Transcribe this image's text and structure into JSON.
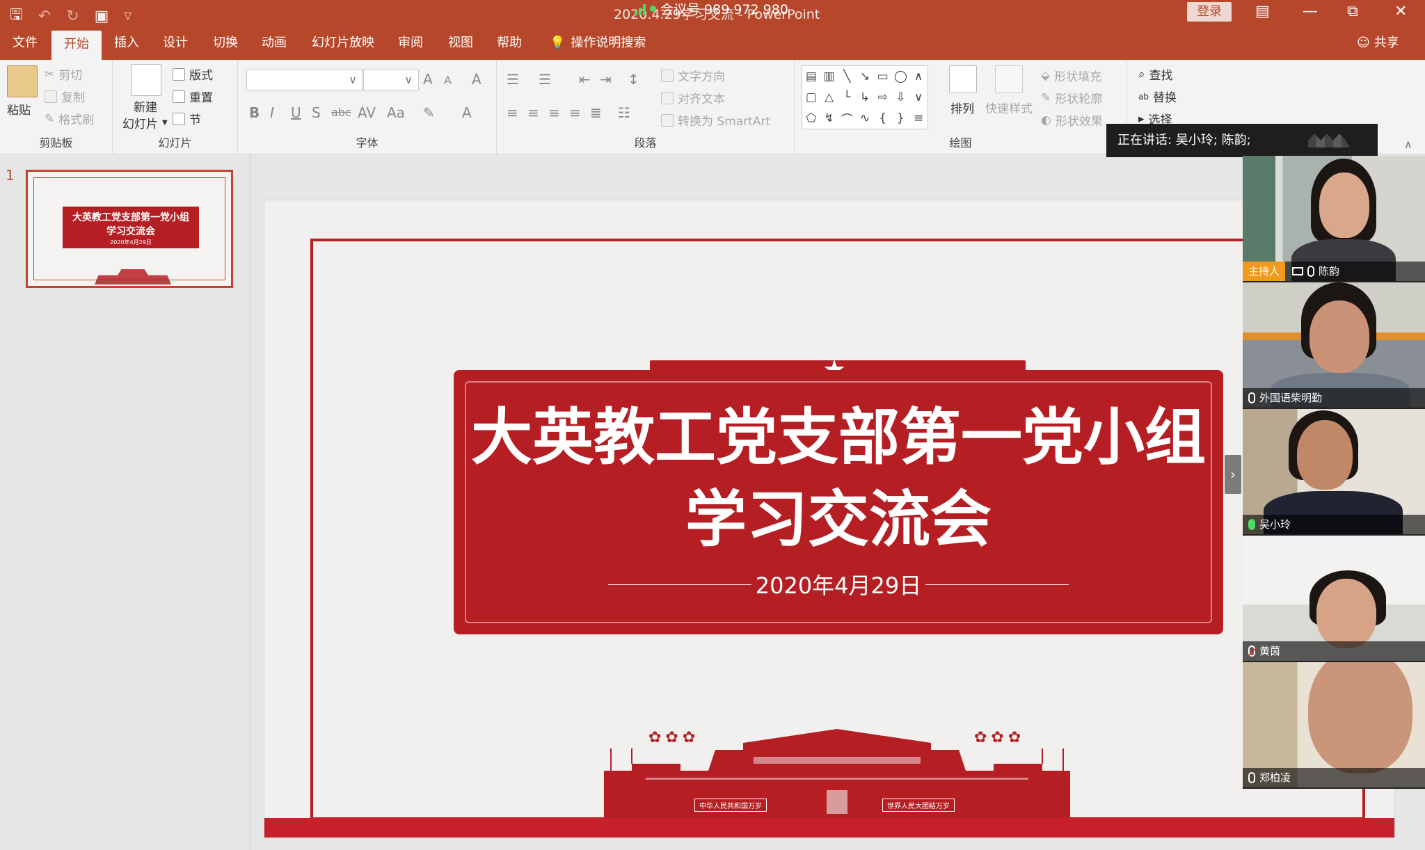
{
  "titlebar": {
    "doc_title": "2020.4.29学习交流 - PowerPoint",
    "meeting_id": "会议号 989 972 980",
    "login": "登录",
    "qat": [
      "save-icon",
      "undo-icon",
      "redo-icon",
      "presenter-icon",
      "customize-icon"
    ]
  },
  "tabs": [
    "文件",
    "开始",
    "插入",
    "设计",
    "切换",
    "动画",
    "幻灯片放映",
    "审阅",
    "视图",
    "帮助"
  ],
  "active_tab": "开始",
  "tell_me": "操作说明搜索",
  "share": "共享",
  "ribbon": {
    "clipboard": {
      "paste": "粘贴",
      "cut": "剪切",
      "copy": "复制",
      "format_painter": "格式刷",
      "label": "剪贴板"
    },
    "slides": {
      "new_slide_1": "新建",
      "new_slide_2": "幻灯片",
      "layout": "版式",
      "reset": "重置",
      "section": "节",
      "label": "幻灯片"
    },
    "font": {
      "label": "字体",
      "bold": "B",
      "italic": "I",
      "underline": "U",
      "shadow": "S",
      "strike": "abc",
      "spacing": "AV",
      "case": "Aa",
      "grow": "A",
      "shrink": "A",
      "clear": "A",
      "color": "A"
    },
    "paragraph": {
      "label": "段落",
      "text_direction": "文字方向",
      "align_text": "对齐文本",
      "smartart": "转换为 SmartArt"
    },
    "drawing": {
      "label": "绘图",
      "arrange": "排列",
      "quick_styles": "快速样式",
      "shape_fill": "形状填充",
      "shape_outline": "形状轮廓",
      "shape_effects": "形状效果"
    },
    "editing": {
      "find": "查找",
      "replace": "替换",
      "select": "选择"
    }
  },
  "thumbnail": {
    "number": "1",
    "title_line1": "大英教工党支部第一党小组",
    "title_line2": "学习交流会",
    "date": "2020年4月29日"
  },
  "slide": {
    "title_line1": "大英教工党支部第一党小组",
    "title_line2": "学习交流会",
    "date": "2020年4月29日",
    "gate_left": "中华人民共和国万岁",
    "gate_right": "世界人民大团结万岁"
  },
  "meeting": {
    "speaking": "正在讲话: 吴小玲; 陈韵;",
    "host_label": "主持人",
    "participants": [
      {
        "name": "陈韵",
        "host": true,
        "mic": "on"
      },
      {
        "name": "外国语柴明勤",
        "host": false,
        "mic": "on"
      },
      {
        "name": "吴小玲",
        "host": false,
        "mic": "speaking"
      },
      {
        "name": "黄茵",
        "host": false,
        "mic": "muted"
      },
      {
        "name": "郑柏凌",
        "host": false,
        "mic": "on"
      }
    ]
  },
  "colors": {
    "accent": "#b7472a",
    "slide_red": "#b51f24",
    "host_badge": "#f29a1d"
  }
}
